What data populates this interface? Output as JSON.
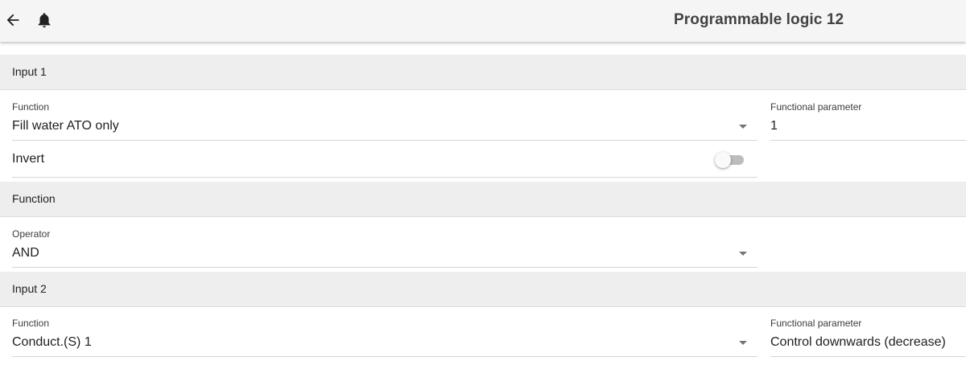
{
  "toolbar": {
    "title": "Programmable logic 12",
    "back_icon": "arrow-back-icon",
    "notification_icon": "bell-icon"
  },
  "input1": {
    "header": "Input 1",
    "function_label": "Function",
    "function_value": "Fill water ATO only",
    "param_label": "Functional parameter",
    "param_value": "1",
    "invert_label": "Invert",
    "invert_on": false
  },
  "function": {
    "header": "Function",
    "operator_label": "Operator",
    "operator_value": "AND"
  },
  "input2": {
    "header": "Input 2",
    "function_label": "Function",
    "function_value": "Conduct.(S) 1",
    "param_label": "Functional parameter",
    "param_value": "Control downwards (decrease)"
  },
  "colors": {
    "toolbar_bg": "#f5f5f5",
    "section_bg": "#eeeeee",
    "text": "#212121",
    "toggle_off_track": "#bdbdbd"
  }
}
